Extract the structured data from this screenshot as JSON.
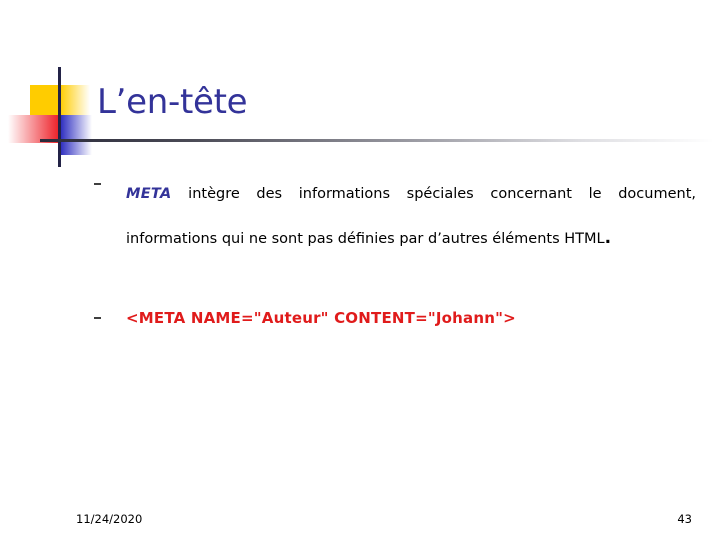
{
  "slide": {
    "title": "L’en-tête",
    "decoration": {
      "yellow": "#FFCC00",
      "red": "#ED1C24",
      "blue": "#2A2ABF",
      "line": "#232347"
    },
    "title_color": "#333399",
    "rule_color_start": "#2a2a3a",
    "rule_color_end": "#ffffff"
  },
  "content": {
    "bullets": [
      {
        "marker": "dash-bullet",
        "keyword": "META",
        "keyword_color": "#333399",
        "line1": " intègre des informations spéciales concernant le",
        "line2": "document, informations qui ne sont pas définies par d’autres",
        "line3": "éléments HTML",
        "line3_end": "."
      },
      {
        "marker": "dash-bullet",
        "code": "<META NAME=\"Auteur\" CONTENT=\"Johann\">",
        "code_color": "#E01B1B"
      }
    ]
  },
  "footer": {
    "date": "11/24/2020",
    "page_number": "43"
  }
}
